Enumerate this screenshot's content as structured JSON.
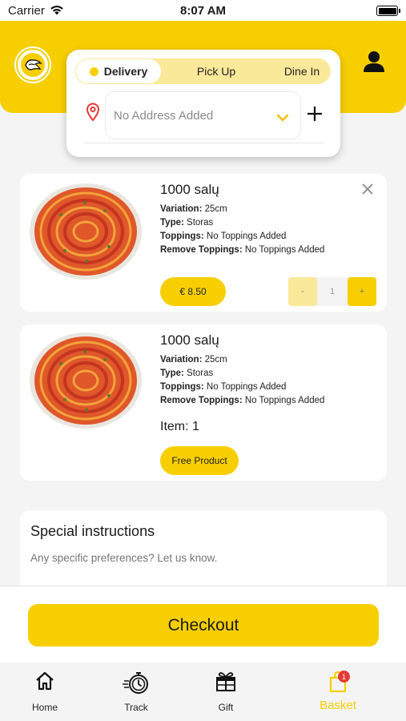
{
  "status_bar": {
    "carrier": "Carrier",
    "time": "8:07 AM"
  },
  "order_type": {
    "tabs": [
      {
        "label": "Delivery",
        "selected": true
      },
      {
        "label": "Pick Up",
        "selected": false
      },
      {
        "label": "Dine In",
        "selected": false
      }
    ],
    "address_placeholder": "No Address Added"
  },
  "cart": {
    "items": [
      {
        "name": "1000 salų",
        "details": [
          {
            "label": "Variation:",
            "value": "25cm"
          },
          {
            "label": "Type:",
            "value": "Storas"
          },
          {
            "label": "Toppings:",
            "value": "No Toppings Added"
          },
          {
            "label": "Remove Toppings:",
            "value": "No Toppings Added"
          }
        ],
        "price": "€ 8.50",
        "quantity": "1",
        "stepper": {
          "minus": "-",
          "plus": "+"
        }
      },
      {
        "name": "1000 salų",
        "details": [
          {
            "label": "Variation:",
            "value": "25cm"
          },
          {
            "label": "Type:",
            "value": "Storas"
          },
          {
            "label": "Toppings:",
            "value": "No Toppings Added"
          },
          {
            "label": "Remove Toppings:",
            "value": "No Toppings Added"
          }
        ],
        "item_count": "Item: 1",
        "free_label": "Free Product"
      }
    ]
  },
  "special_instructions": {
    "title": "Special instructions",
    "placeholder": "Any specific preferences? Let us know."
  },
  "checkout": {
    "label": "Checkout"
  },
  "tab_bar": {
    "items": [
      {
        "label": "Home",
        "icon": "home-icon",
        "active": false
      },
      {
        "label": "Track",
        "icon": "stopwatch-icon",
        "active": false
      },
      {
        "label": "Gift",
        "icon": "gift-icon",
        "active": false
      },
      {
        "label": "Basket",
        "icon": "basket-icon",
        "active": true,
        "badge": "1"
      }
    ]
  },
  "colors": {
    "accent": "#f7cf00",
    "accent_light": "#fbe99a",
    "badge": "#e53935",
    "pin": "#e53935"
  }
}
